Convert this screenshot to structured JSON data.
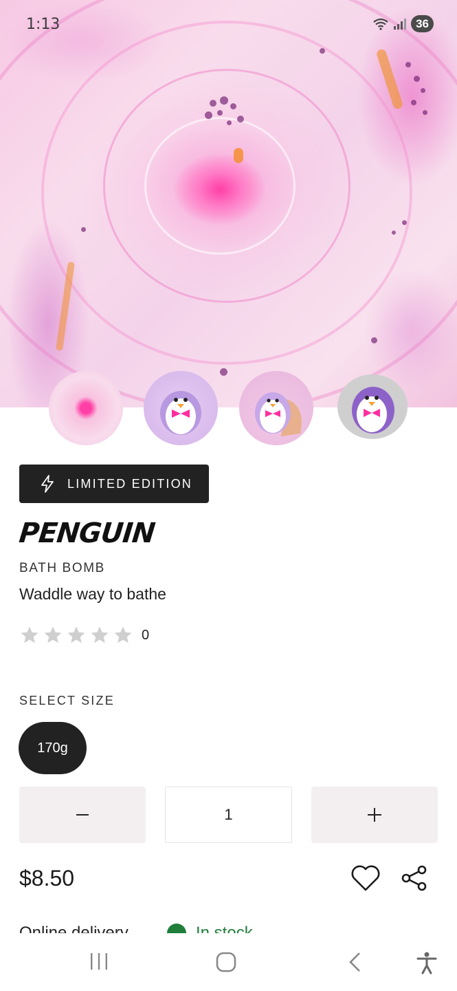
{
  "status_bar": {
    "time": "1:13",
    "battery": "36",
    "icons": [
      "wifi-icon",
      "signal-icon",
      "battery-icon"
    ]
  },
  "hero": {
    "image": "pink and purple swirling bath bomb water"
  },
  "thumbnails": [
    {
      "name": "thumbnail-bath-water"
    },
    {
      "name": "thumbnail-penguin-front"
    },
    {
      "name": "thumbnail-penguin-in-hand"
    },
    {
      "name": "thumbnail-penguin-side"
    }
  ],
  "badge": {
    "icon": "lightning-bolt-icon",
    "label": "LIMITED EDITION"
  },
  "product": {
    "title": "PENGUIN",
    "category": "BATH BOMB",
    "tagline": "Waddle way to bathe",
    "rating_stars": 0,
    "rating_max": 5,
    "review_count": "0"
  },
  "size": {
    "label": "SELECT SIZE",
    "options": [
      "170g"
    ],
    "selected": "170g"
  },
  "quantity": {
    "value": "1"
  },
  "price": "$8.50",
  "actions": [
    "heart-icon",
    "share-icon"
  ],
  "delivery": {
    "label": "Online delivery",
    "status": "In stock"
  },
  "nav_bar": {
    "buttons": [
      "recent-apps-icon",
      "home-icon",
      "back-icon",
      "accessibility-icon"
    ]
  },
  "colors": {
    "accent_dark": "#222222",
    "stock_green": "#1e7e3a",
    "qty_bg": "#f3eff1",
    "hero_pink": "#ff3fa6"
  }
}
